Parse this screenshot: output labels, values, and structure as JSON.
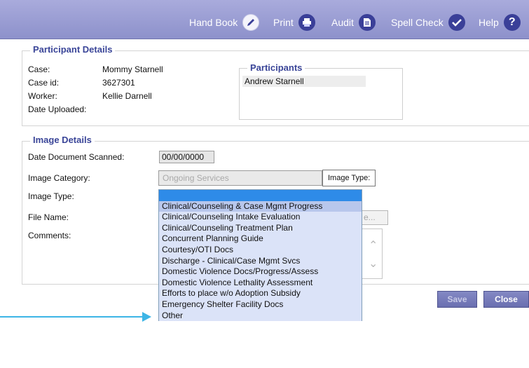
{
  "toolbar": {
    "items": [
      {
        "label": "Hand Book",
        "icon": "pencil-icon"
      },
      {
        "label": "Print",
        "icon": "printer-icon"
      },
      {
        "label": "Audit",
        "icon": "document-icon"
      },
      {
        "label": "Spell Check",
        "icon": "spell-check-icon"
      },
      {
        "label": "Help",
        "icon": "help-icon",
        "glyph": "?"
      }
    ]
  },
  "participant_details": {
    "legend": "Participant Details",
    "case_label": "Case:",
    "case_value": "Mommy Starnell",
    "case_id_label": "Case id:",
    "case_id_value": "3627301",
    "worker_label": "Worker:",
    "worker_value": "Kellie Darnell",
    "date_uploaded_label": "Date Uploaded:",
    "participants": {
      "legend": "Participants",
      "items": [
        "Andrew Starnell"
      ]
    }
  },
  "image_details": {
    "legend": "Image Details",
    "date_scanned_label": "Date Document Scanned:",
    "date_scanned_value": "00/00/0000",
    "image_category_label": "Image Category:",
    "image_category_value": "Ongoing Services",
    "image_type_tooltip": "Image Type:",
    "image_type_label": "Image Type:",
    "file_name_label": "File Name:",
    "browse_partial": "e...",
    "comments_label": "Comments:"
  },
  "image_type_dropdown": {
    "selected_index": 0,
    "hovered_index": 1,
    "options": [
      "",
      "Clinical/Counseling & Case Mgmt Progress",
      "Clinical/Counseling Intake Evaluation",
      "Clinical/Counseling Treatment Plan",
      "Concurrent Planning Guide",
      "Courtesy/OTI Docs",
      "Discharge - Clinical/Case Mgmt Svcs",
      "Domestic Violence Docs/Progress/Assess",
      "Domestic Violence Lethality Assessment",
      "Efforts to place w/o Adoption Subsidy",
      "Emergency Shelter Facility Docs",
      "Other"
    ]
  },
  "buttons": {
    "save": "Save",
    "close": "Close"
  },
  "colors": {
    "toolbar": "#8d91cb",
    "legend_text": "#3a4598",
    "selection": "#2e8be8",
    "callout_arrow": "#3db5e6"
  }
}
